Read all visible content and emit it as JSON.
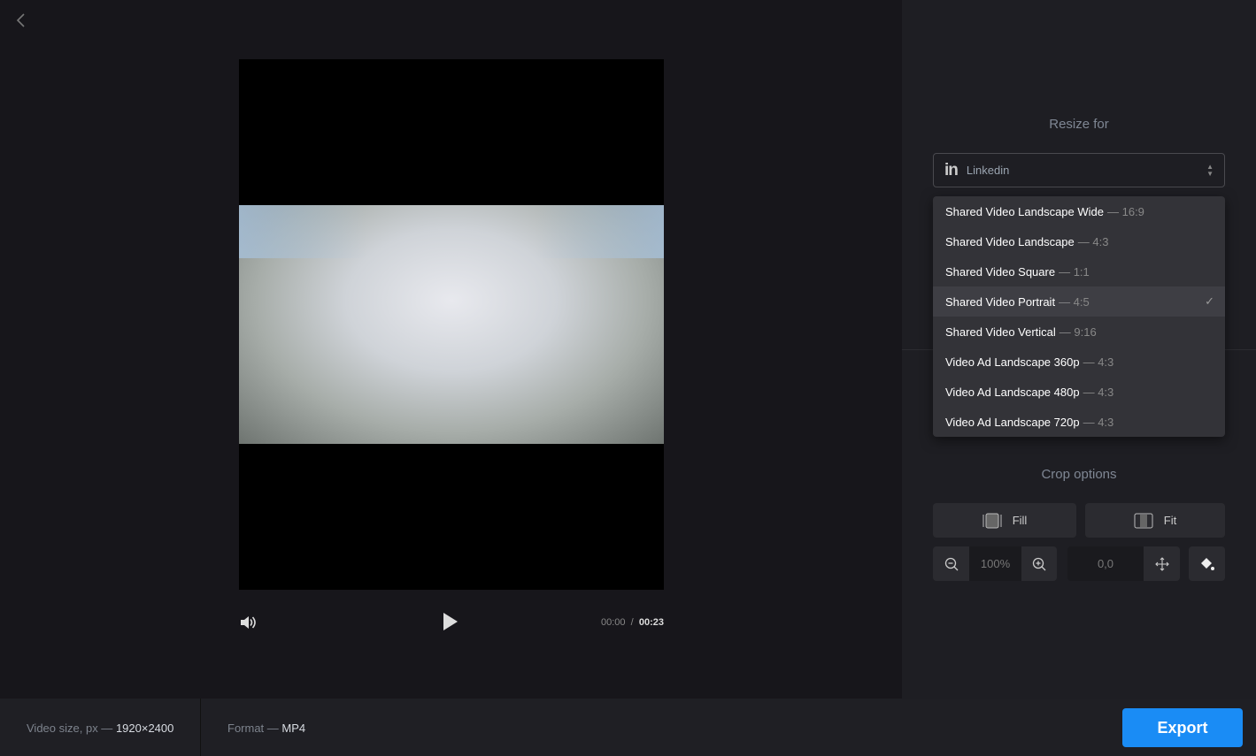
{
  "player": {
    "current_time": "00:00",
    "separator": "/",
    "duration": "00:23"
  },
  "panel": {
    "resize_title": "Resize for",
    "platform": "Linkedin",
    "platform_icon": "in",
    "options": [
      {
        "name": "Shared Video Landscape Wide",
        "ratio": "— 16:9",
        "selected": false
      },
      {
        "name": "Shared Video Landscape",
        "ratio": "— 4:3",
        "selected": false
      },
      {
        "name": "Shared Video Square",
        "ratio": "— 1:1",
        "selected": false
      },
      {
        "name": "Shared Video Portrait",
        "ratio": "— 4:5",
        "selected": true
      },
      {
        "name": "Shared Video Vertical",
        "ratio": "— 9:16",
        "selected": false
      },
      {
        "name": "Video Ad Landscape 360p",
        "ratio": "— 4:3",
        "selected": false
      },
      {
        "name": "Video Ad Landscape 480p",
        "ratio": "— 4:3",
        "selected": false
      },
      {
        "name": "Video Ad Landscape 720p",
        "ratio": "— 4:3",
        "selected": false
      }
    ],
    "crop_title": "Crop options",
    "fill_label": "Fill",
    "fit_label": "Fit",
    "zoom_value": "100%",
    "position_value": "0,0"
  },
  "footer": {
    "size_label": "Video size, px —",
    "size_value": "1920×2400",
    "format_label": "Format —",
    "format_value": "MP4",
    "export_label": "Export"
  },
  "colors": {
    "accent": "#1a8cf5"
  }
}
